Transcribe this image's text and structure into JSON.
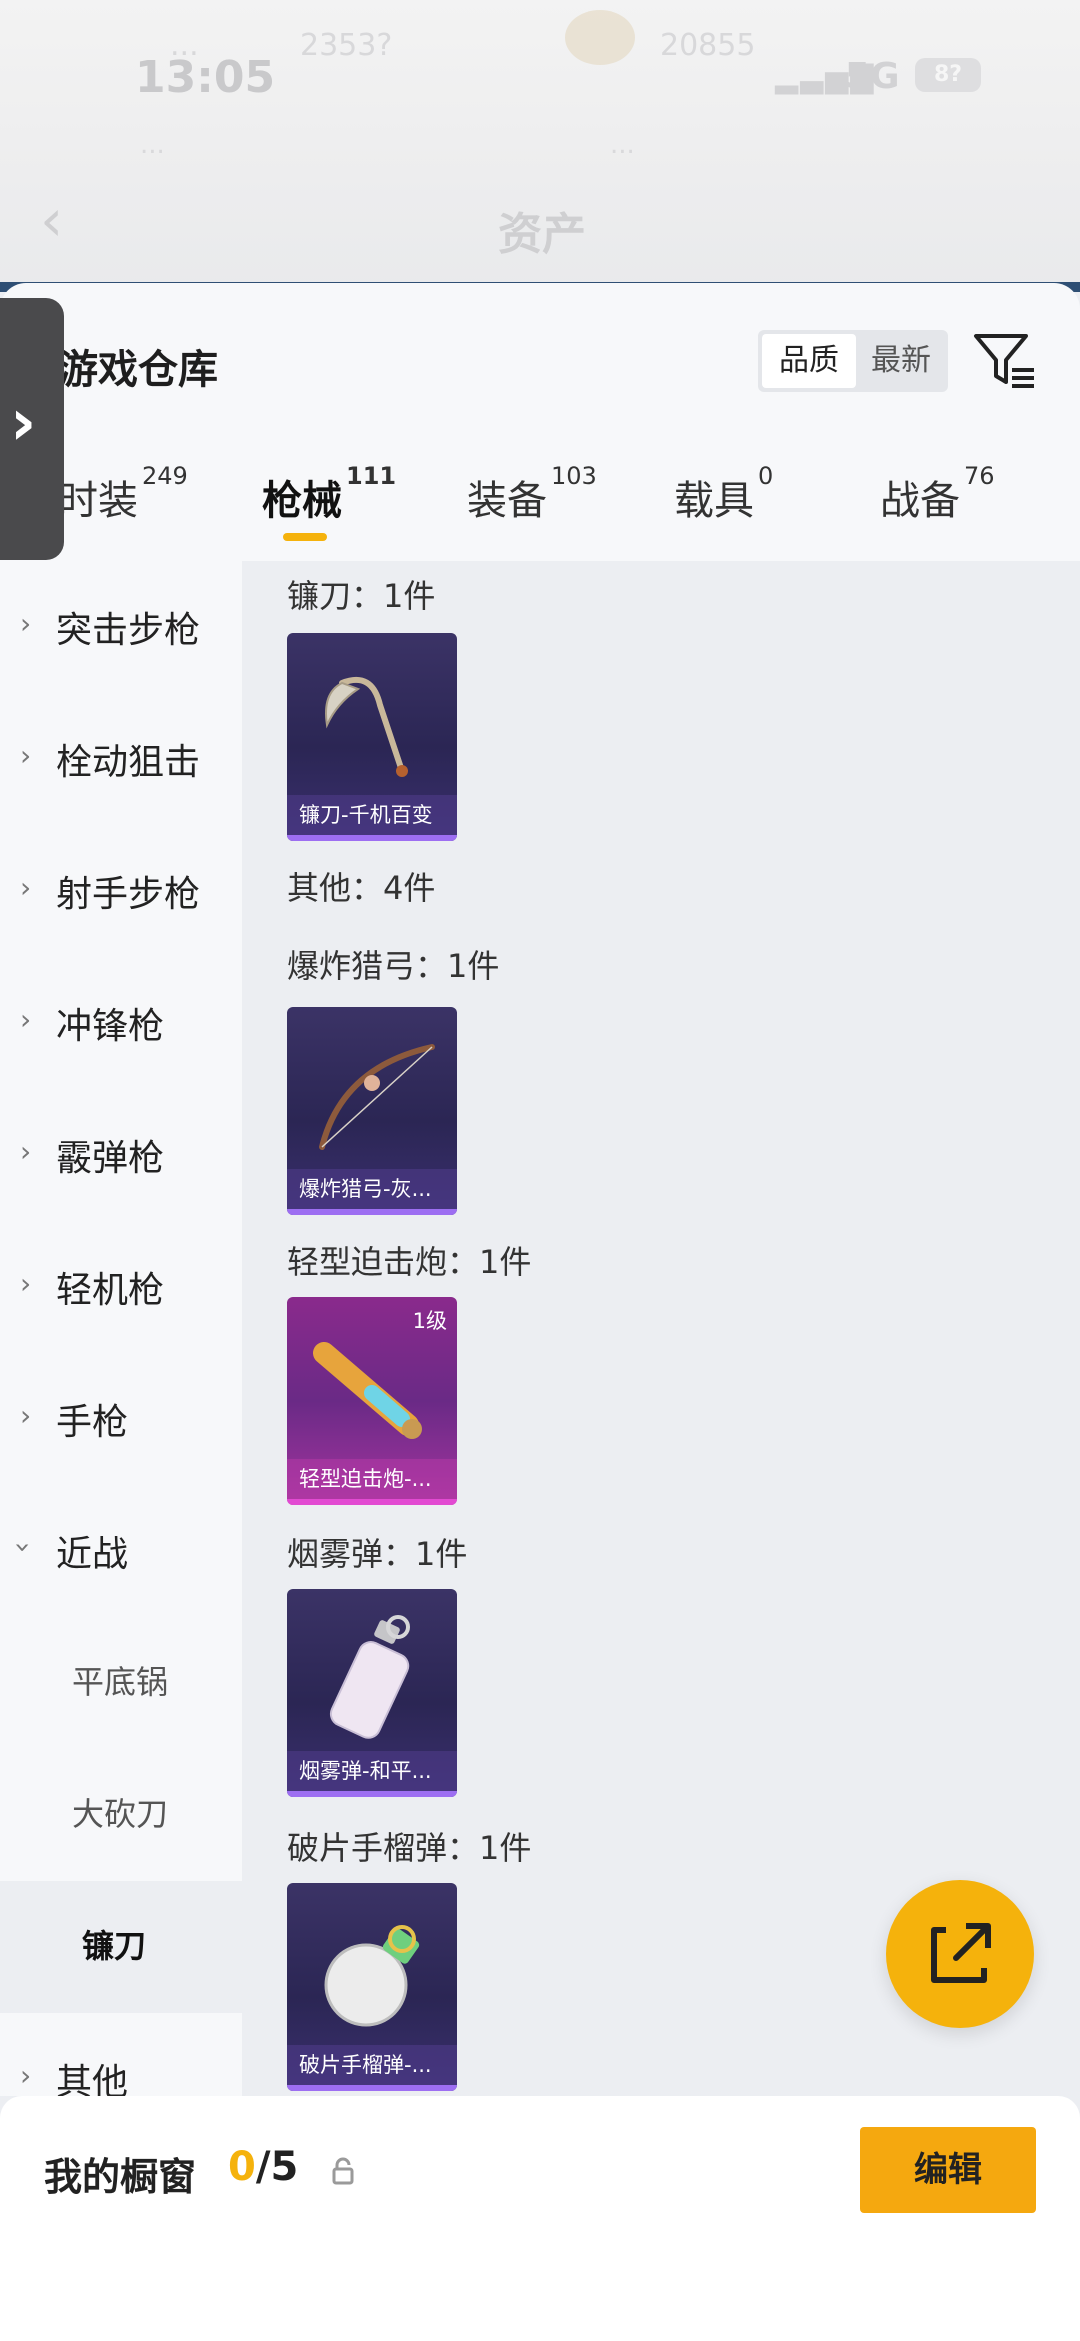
{
  "status_bar": {
    "time": "13:05",
    "left_a": "...",
    "left_b": "2353?",
    "right_a": "20855",
    "network": "5G",
    "battery": "8?"
  },
  "header": {
    "title": "资产",
    "sub_left": "...",
    "sub_right": "..."
  },
  "warehouse": {
    "title": "游戏仓库",
    "sort_options": [
      "品质",
      "最新"
    ],
    "selected_sort": "品质"
  },
  "tabs": [
    {
      "label": "时装",
      "count": "249"
    },
    {
      "label": "枪械",
      "count": "111",
      "active": true
    },
    {
      "label": "装备",
      "count": "103"
    },
    {
      "label": "载具",
      "count": "0"
    },
    {
      "label": "战备",
      "count": "76"
    }
  ],
  "categories": [
    {
      "label": "突击步枪",
      "expanded": false
    },
    {
      "label": "栓动狙击",
      "expanded": false
    },
    {
      "label": "射手步枪",
      "expanded": false
    },
    {
      "label": "冲锋枪",
      "expanded": false
    },
    {
      "label": "霰弹枪",
      "expanded": false
    },
    {
      "label": "轻机枪",
      "expanded": false
    },
    {
      "label": "手枪",
      "expanded": false
    },
    {
      "label": "近战",
      "expanded": true
    },
    {
      "label": "平底锅",
      "sub": true
    },
    {
      "label": "大砍刀",
      "sub": true
    },
    {
      "label": "镰刀",
      "sub": true,
      "selected": true
    },
    {
      "label": "其他",
      "expanded": false
    }
  ],
  "content": {
    "groups": [
      {
        "label": "镰刀：1件",
        "item": {
          "name": "镰刀-千机百变",
          "icon": "scythe-icon",
          "rarity": "epic"
        }
      },
      {
        "label": "其他：4件",
        "item": null
      },
      {
        "label": "爆炸猎弓：1件",
        "item": {
          "name": "爆炸猎弓-灰...",
          "icon": "bow-icon",
          "rarity": "epic"
        }
      },
      {
        "label": "轻型迫击炮：1件",
        "item": {
          "name": "轻型迫击炮-...",
          "icon": "mortar-icon",
          "rarity": "legendary",
          "level": "1级"
        }
      },
      {
        "label": "烟雾弹：1件",
        "item": {
          "name": "烟雾弹-和平...",
          "icon": "smoke-grenade-icon",
          "rarity": "epic"
        }
      },
      {
        "label": "破片手榴弹：1件",
        "item": {
          "name": "破片手榴弹-...",
          "icon": "frag-grenade-icon",
          "rarity": "epic"
        }
      }
    ]
  },
  "bottom_bar": {
    "showcase_label": "我的橱窗",
    "showcase_used": "0",
    "showcase_total": "/5",
    "edit_label": "编辑"
  },
  "colors": {
    "accent": "#f5b20c",
    "epic_card": "#2b2654",
    "legendary_card": "#8a2a8c"
  }
}
